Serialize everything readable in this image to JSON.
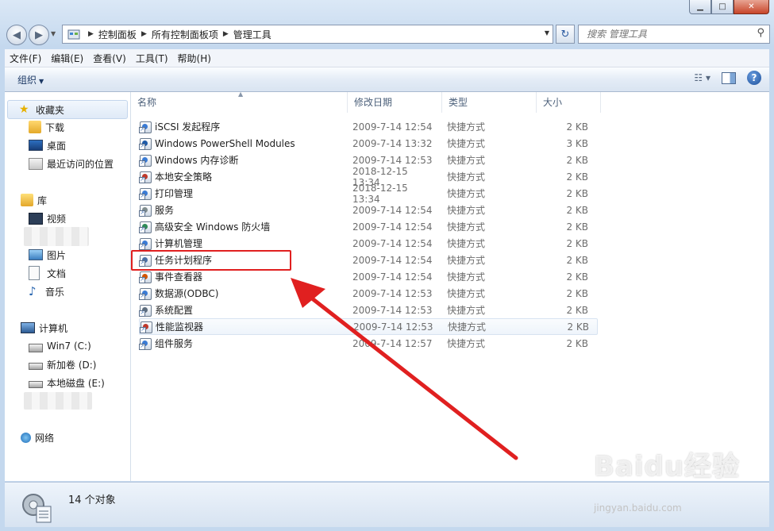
{
  "address_bar": {
    "crumbs": [
      "控制面板",
      "所有控制面板项",
      "管理工具"
    ]
  },
  "search": {
    "placeholder": "搜索 管理工具"
  },
  "menu": [
    "文件(F)",
    "编辑(E)",
    "查看(V)",
    "工具(T)",
    "帮助(H)"
  ],
  "toolbar": {
    "organize_label": "组织"
  },
  "nav": {
    "favorites": {
      "label": "收藏夹",
      "items": [
        "下载",
        "桌面",
        "最近访问的位置"
      ]
    },
    "libraries": {
      "label": "库",
      "items": [
        "视频",
        "图片",
        "文档",
        "音乐"
      ]
    },
    "computer": {
      "label": "计算机",
      "items": [
        "Win7 (C:)",
        "新加卷 (D:)",
        "本地磁盘 (E:)"
      ]
    },
    "network": {
      "label": "网络"
    }
  },
  "columns": [
    "名称",
    "修改日期",
    "类型",
    "大小"
  ],
  "files": [
    {
      "name": "iSCSI 发起程序",
      "date": "2009-7-14 12:54",
      "type": "快捷方式",
      "size": "2 KB"
    },
    {
      "name": "Windows PowerShell Modules",
      "date": "2009-7-14 13:32",
      "type": "快捷方式",
      "size": "3 KB"
    },
    {
      "name": "Windows 内存诊断",
      "date": "2009-7-14 12:53",
      "type": "快捷方式",
      "size": "2 KB"
    },
    {
      "name": "本地安全策略",
      "date": "2018-12-15 13:34",
      "type": "快捷方式",
      "size": "2 KB"
    },
    {
      "name": "打印管理",
      "date": "2018-12-15 13:34",
      "type": "快捷方式",
      "size": "2 KB"
    },
    {
      "name": "服务",
      "date": "2009-7-14 12:54",
      "type": "快捷方式",
      "size": "2 KB"
    },
    {
      "name": "高级安全 Windows 防火墙",
      "date": "2009-7-14 12:54",
      "type": "快捷方式",
      "size": "2 KB"
    },
    {
      "name": "计算机管理",
      "date": "2009-7-14 12:54",
      "type": "快捷方式",
      "size": "2 KB"
    },
    {
      "name": "任务计划程序",
      "date": "2009-7-14 12:54",
      "type": "快捷方式",
      "size": "2 KB"
    },
    {
      "name": "事件查看器",
      "date": "2009-7-14 12:54",
      "type": "快捷方式",
      "size": "2 KB"
    },
    {
      "name": "数据源(ODBC)",
      "date": "2009-7-14 12:53",
      "type": "快捷方式",
      "size": "2 KB"
    },
    {
      "name": "系统配置",
      "date": "2009-7-14 12:53",
      "type": "快捷方式",
      "size": "2 KB"
    },
    {
      "name": "性能监视器",
      "date": "2009-7-14 12:53",
      "type": "快捷方式",
      "size": "2 KB"
    },
    {
      "name": "组件服务",
      "date": "2009-7-14 12:57",
      "type": "快捷方式",
      "size": "2 KB"
    }
  ],
  "status": {
    "count_text": "14 个对象"
  },
  "watermark": {
    "brand": "Baidu经验",
    "url": "jingyan.baidu.com"
  },
  "colors": {
    "highlight": "#e02020",
    "accent_blue": "#2b63b0"
  }
}
